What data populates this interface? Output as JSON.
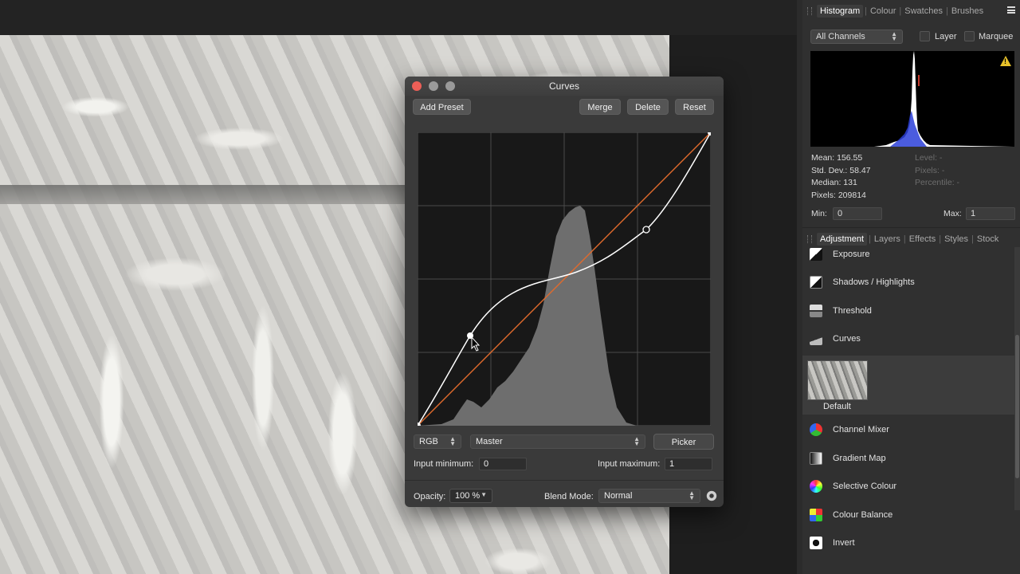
{
  "histogram_panel": {
    "tabs": [
      "Histogram",
      "Colour",
      "Swatches",
      "Brushes"
    ],
    "active_tab": "Histogram",
    "channel": "All Channels",
    "layer_label": "Layer",
    "marquee_label": "Marquee",
    "stats": {
      "mean": "Mean: 156.55",
      "std_dev": "Std. Dev.: 58.47",
      "median": "Median: 131",
      "pixels": "Pixels: 209814",
      "level": "Level: -",
      "pixels_sel": "Pixels: -",
      "percentile": "Percentile: -"
    },
    "min_label": "Min:",
    "min_value": "0",
    "max_label": "Max:",
    "max_value": "1",
    "warning_color": "#e8c22a"
  },
  "adjustment_panel": {
    "tabs": [
      "Adjustment",
      "Layers",
      "Effects",
      "Styles",
      "Stock"
    ],
    "active_tab": "Adjustment",
    "items": [
      {
        "label": "Exposure",
        "icon": "exposure-icon"
      },
      {
        "label": "Shadows / Highlights",
        "icon": "shadows-highlights-icon"
      },
      {
        "label": "Threshold",
        "icon": "threshold-icon"
      },
      {
        "label": "Curves",
        "icon": "curves-icon"
      },
      {
        "label": "Channel Mixer",
        "icon": "channel-mixer-icon"
      },
      {
        "label": "Gradient Map",
        "icon": "gradient-map-icon"
      },
      {
        "label": "Selective Colour",
        "icon": "selective-colour-icon"
      },
      {
        "label": "Colour Balance",
        "icon": "colour-balance-icon"
      },
      {
        "label": "Invert",
        "icon": "invert-icon"
      }
    ],
    "curves_preset": "Default"
  },
  "curves_dialog": {
    "title": "Curves",
    "add_preset": "Add Preset",
    "merge": "Merge",
    "delete": "Delete",
    "reset": "Reset",
    "color_space": "RGB",
    "channel": "Master",
    "picker": "Picker",
    "input_min_label": "Input minimum:",
    "input_min_value": "0",
    "input_max_label": "Input maximum:",
    "input_max_value": "1",
    "opacity_label": "Opacity:",
    "opacity_value": "100 %",
    "blend_label": "Blend Mode:",
    "blend_value": "Normal",
    "curve_color": "#ffffff",
    "diagonal_color": "#e06a2c",
    "control_points": [
      [
        0,
        0
      ],
      [
        0.18,
        0.3
      ],
      [
        0.78,
        0.67
      ],
      [
        1,
        1
      ]
    ]
  }
}
